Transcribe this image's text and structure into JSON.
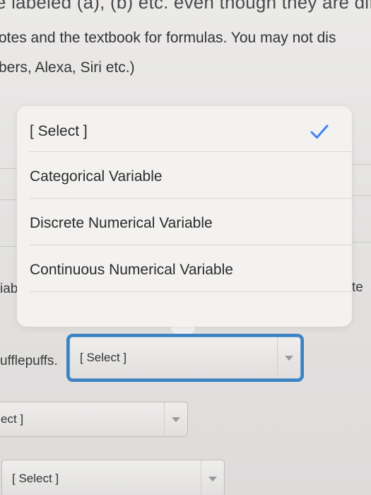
{
  "page": {
    "top_line": "e labeled (a), (b) etc. even though they are different",
    "intro_line_1": "otes and the textbook for formulas. You may not dis",
    "intro_line_2": "bers, Alexa, Siri etc.)"
  },
  "side_text": {
    "left_fragment": "iab",
    "right_fragment": "te",
    "question_label": "ufflepuffs."
  },
  "dropdown_menu": {
    "selected_index": 0,
    "options": [
      {
        "label": "[ Select ]"
      },
      {
        "label": "Categorical Variable"
      },
      {
        "label": "Discrete Numerical Variable"
      },
      {
        "label": "Continuous Numerical Variable"
      }
    ],
    "check_icon": "checkmark-icon",
    "check_color": "#3b82f6"
  },
  "selects": {
    "active": {
      "value": "[ Select ]"
    },
    "second": {
      "value": "ect ]"
    },
    "third": {
      "value": "[ Select ]"
    }
  },
  "colors": {
    "focus_ring": "#3b82c4"
  }
}
